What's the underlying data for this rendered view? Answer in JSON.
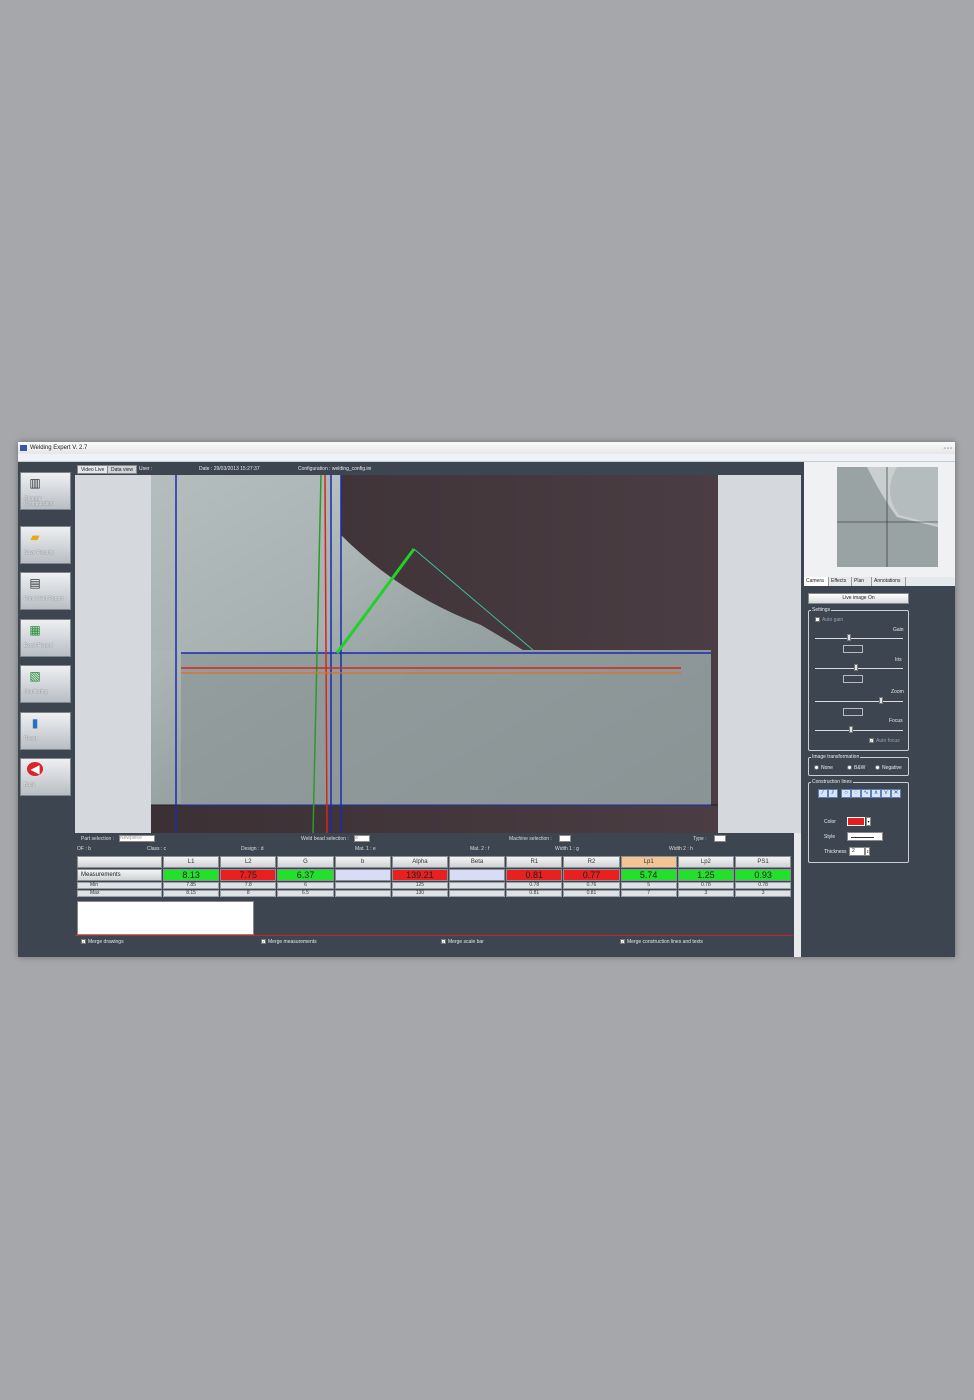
{
  "window": {
    "title": "Welding Expert V.  2.7"
  },
  "sidebar": {
    "items": [
      {
        "label": "Change Configuration",
        "icon": "config-icon"
      },
      {
        "label": "Save Results",
        "icon": "folder-icon"
      },
      {
        "label": "Print Weld Report",
        "icon": "printer-icon"
      },
      {
        "label": "Excel Report",
        "icon": "excel-icon"
      },
      {
        "label": "Monitoring",
        "icon": "monitoring-icon"
      },
      {
        "label": "Reset",
        "icon": "trash-icon"
      },
      {
        "label": "Back",
        "icon": "back-arrow-icon"
      }
    ]
  },
  "tabs": [
    {
      "label": "Video Live"
    },
    {
      "label": "Data view"
    }
  ],
  "info": {
    "user": "User :",
    "date": "Date : 29/03/2013 15:27:37",
    "config": "Configuration : welding_config.ini"
  },
  "selectors": {
    "part_label": "Part selection :",
    "part_value": "Newpiece",
    "bead_label": "Weld bead selection :",
    "bead_value": "a",
    "machine_label": "Machine selection :",
    "type_label": "Type :",
    "of": "OF : b",
    "class": "Class : c",
    "design": "Design : d",
    "mat1": "Mat. 1 : e",
    "mat2": "Mat. 2 : f",
    "width1": "Width 1 : g",
    "width2": "Width 2 : h"
  },
  "table": {
    "columns": [
      "L1",
      "L2",
      "G",
      "b",
      "Alpha",
      "Beta",
      "R1",
      "R2",
      "Lp1",
      "Lp2",
      "PS1"
    ],
    "row_labels": {
      "measure": "Measurements",
      "min": "Min",
      "max": "Max"
    },
    "measurements": [
      "8.13",
      "7.75",
      "6.37",
      "",
      "139.21",
      "",
      "0.81",
      "0.77",
      "5.74",
      "1.25",
      "0.93"
    ],
    "status": [
      "ok",
      "bad",
      "ok",
      "none",
      "bad",
      "none",
      "bad",
      "bad",
      "ok",
      "ok",
      "ok"
    ],
    "min": [
      "7.85",
      "7.8",
      "6",
      "",
      "125",
      "",
      "0.78",
      "0.76",
      "5",
      "0.78",
      "0.78"
    ],
    "max": [
      "8.15",
      "8",
      "6.5",
      "",
      "130",
      "",
      "0.81",
      "0.81",
      "7",
      "3",
      "3"
    ]
  },
  "checkboxes": [
    {
      "label": "Merge drawings"
    },
    {
      "label": "Merge measurements"
    },
    {
      "label": "Merge scale bar"
    },
    {
      "label": "Merge construction lines and texts"
    }
  ],
  "right": {
    "tabs": [
      "Camera",
      "Effects",
      "Plan",
      "Annotations"
    ],
    "live_button": "Live image On",
    "settings_title": "Settings",
    "auto_gain": "Auto gain",
    "gain": "Gain",
    "iris": "Iris",
    "zoom": "Zoom",
    "focus": "Focus",
    "auto_focus": "Auto focus",
    "transform_title": "Image transformation",
    "transform_options": [
      "None",
      "B&W",
      "Negative"
    ],
    "construction_title": "Construction lines",
    "color_label": "Color",
    "style_label": "Style",
    "thickness_label": "Thickness",
    "thickness_value": "2"
  },
  "colors": {
    "ok": "#22e02c",
    "bad": "#e8201f",
    "none": "#d9dcf5",
    "accent_tab": "#f3c592"
  }
}
